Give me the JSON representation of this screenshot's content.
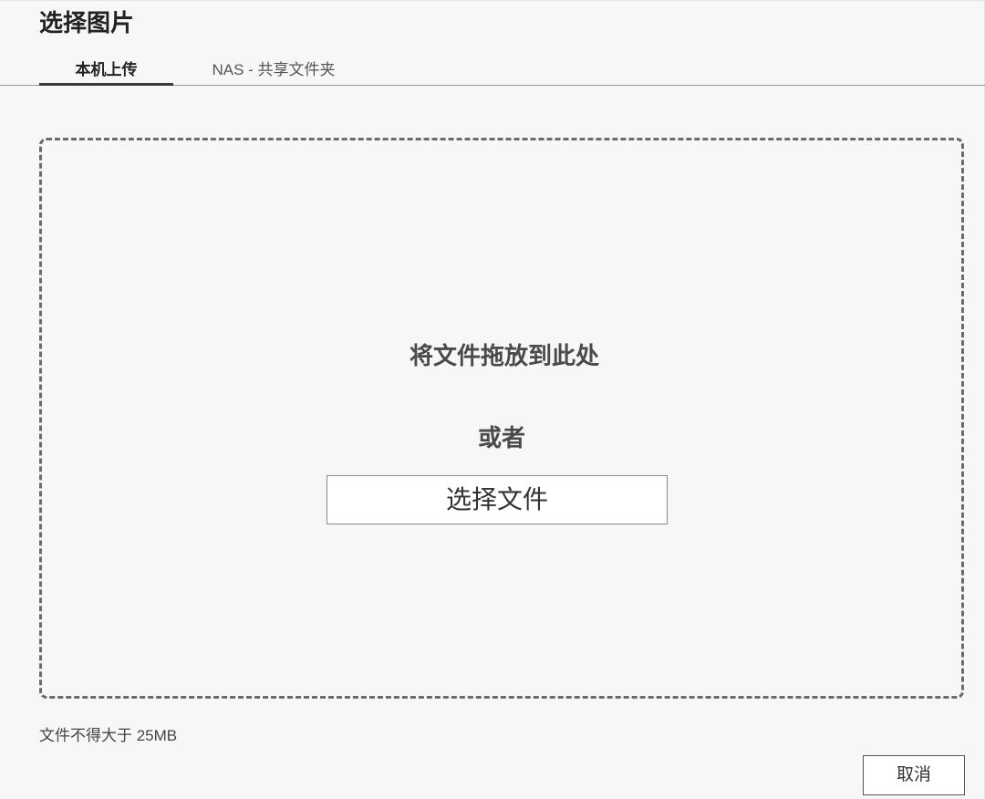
{
  "dialog": {
    "title": "选择图片"
  },
  "tabs": [
    {
      "label": "本机上传",
      "active": true
    },
    {
      "label": "NAS - 共享文件夹",
      "active": false
    }
  ],
  "dropzone": {
    "main_text": "将文件拖放到此处",
    "or_text": "或者",
    "choose_button_label": "选择文件"
  },
  "footer": {
    "size_note": "文件不得大于 25MB",
    "cancel_label": "取消"
  }
}
